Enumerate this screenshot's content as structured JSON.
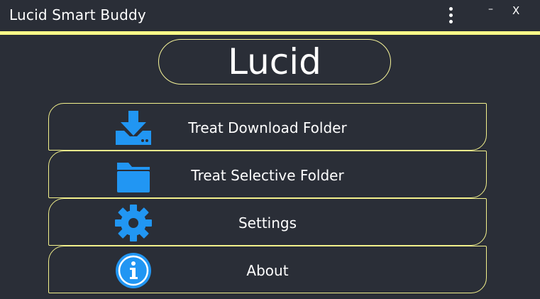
{
  "window": {
    "title": "Lucid Smart Buddy",
    "minimize_label": "–",
    "close_label": "X"
  },
  "logo": {
    "text": "Lucid"
  },
  "menu": {
    "items": [
      {
        "label": "Treat Download Folder",
        "icon": "download-icon"
      },
      {
        "label": "Treat Selective Folder",
        "icon": "folder-icon"
      },
      {
        "label": "Settings",
        "icon": "gear-icon"
      },
      {
        "label": "About",
        "icon": "info-icon"
      }
    ]
  },
  "colors": {
    "background": "#2a2e37",
    "accent": "#ffff88",
    "icon_blue": "#2196f3",
    "text": "#ffffff"
  }
}
